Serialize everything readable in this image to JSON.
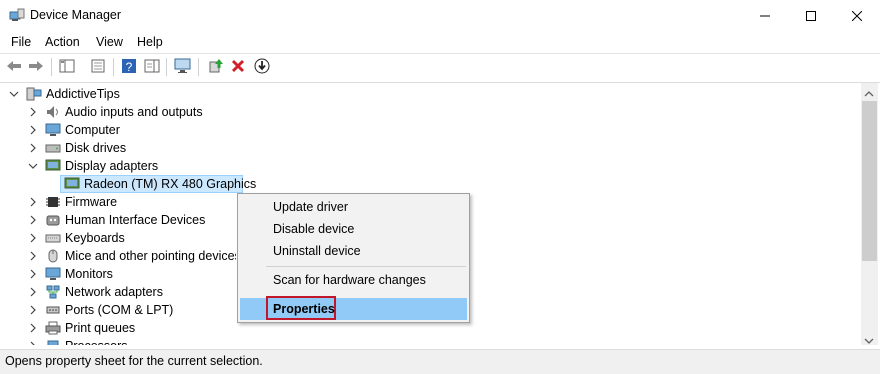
{
  "window": {
    "title": "Device Manager",
    "controls": [
      "minimize",
      "maximize",
      "close"
    ]
  },
  "menu": [
    "File",
    "Action",
    "View",
    "Help"
  ],
  "toolbar": {
    "icons": [
      "back-icon",
      "forward-icon",
      "show-hide-tree-icon",
      "properties-icon",
      "help-icon",
      "action-pane-icon",
      "scan-hardware-icon",
      "update-driver-icon",
      "uninstall-icon",
      "disable-icon"
    ]
  },
  "tree": {
    "root": "AddictiveTips",
    "items": [
      {
        "label": "Audio inputs and outputs",
        "expanded": false
      },
      {
        "label": "Computer",
        "expanded": false
      },
      {
        "label": "Disk drives",
        "expanded": false
      },
      {
        "label": "Display adapters",
        "expanded": true,
        "child": "Radeon (TM) RX 480 Graphics"
      },
      {
        "label": "Firmware",
        "expanded": false
      },
      {
        "label": "Human Interface Devices",
        "expanded": false
      },
      {
        "label": "Keyboards",
        "expanded": false
      },
      {
        "label": "Mice and other pointing devices",
        "expanded": false
      },
      {
        "label": "Monitors",
        "expanded": false
      },
      {
        "label": "Network adapters",
        "expanded": false
      },
      {
        "label": "Ports (COM & LPT)",
        "expanded": false
      },
      {
        "label": "Print queues",
        "expanded": false
      },
      {
        "label": "Processors",
        "expanded": false
      }
    ],
    "selected": "Radeon (TM) RX 480 Graphics"
  },
  "context_menu": {
    "items": [
      "Update driver",
      "Disable device",
      "Uninstall device",
      "Scan for hardware changes",
      "Properties"
    ],
    "highlighted": "Properties"
  },
  "status": "Opens property sheet for the current selection.",
  "colors": {
    "highlight": "#91c9f7",
    "selection": "#cce8ff",
    "annotation": "#c0182a"
  }
}
